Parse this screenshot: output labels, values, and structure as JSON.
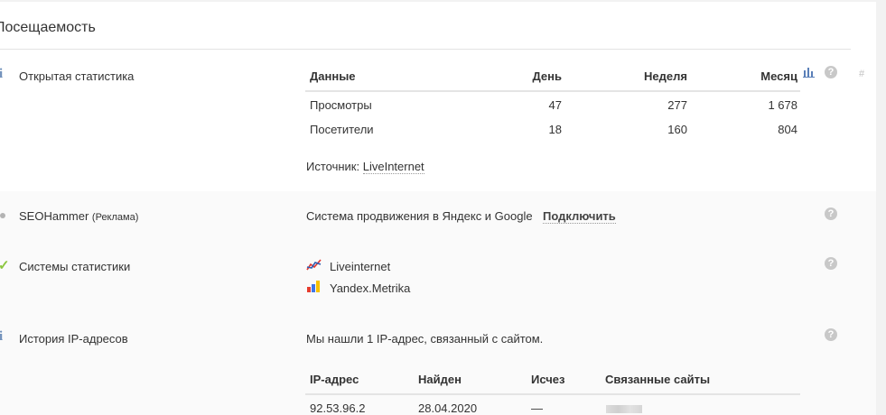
{
  "section": {
    "title": "Посещаемость"
  },
  "open_stats": {
    "label": "Открытая статистика",
    "headers": [
      "Данные",
      "День",
      "Неделя",
      "Месяц"
    ],
    "rows": [
      {
        "name": "Просмотры",
        "day": "47",
        "week": "277",
        "month": "1 678"
      },
      {
        "name": "Посетители",
        "day": "18",
        "week": "160",
        "month": "804"
      }
    ],
    "source_prefix": "Источник:",
    "source_link": "LiveInternet",
    "hash": "#"
  },
  "seohammer": {
    "label": "SEOHammer",
    "ad_note": "(Реклама)",
    "text": "Система продвижения в Яндекс и Google",
    "action": "Подключить"
  },
  "stat_systems": {
    "label": "Системы статистики",
    "items": [
      {
        "name": "Liveinternet",
        "icon": "liveinternet-chart-icon"
      },
      {
        "name": "Yandex.Metrika",
        "icon": "yandex-metrika-bars-icon"
      }
    ]
  },
  "ip_history": {
    "label": "История IP-адресов",
    "text": "Мы нашли 1 IP-адрес, связанный с сайтом.",
    "headers": [
      "IP-адрес",
      "Найден",
      "Исчез",
      "Связанные сайты"
    ],
    "rows": [
      {
        "ip": "92.53.96.2",
        "found": "28.04.2020",
        "gone": "—"
      }
    ]
  },
  "help_symbol": "?",
  "colors": {
    "info_icon": "#6f8fba",
    "check": "#8cc63f",
    "liveinternet_red": "#e2342d",
    "liveinternet_blue": "#2f5fb3",
    "metrika_yellow": "#f7c200",
    "metrika_red": "#e63d2e",
    "metrika_blue": "#4076e8"
  }
}
